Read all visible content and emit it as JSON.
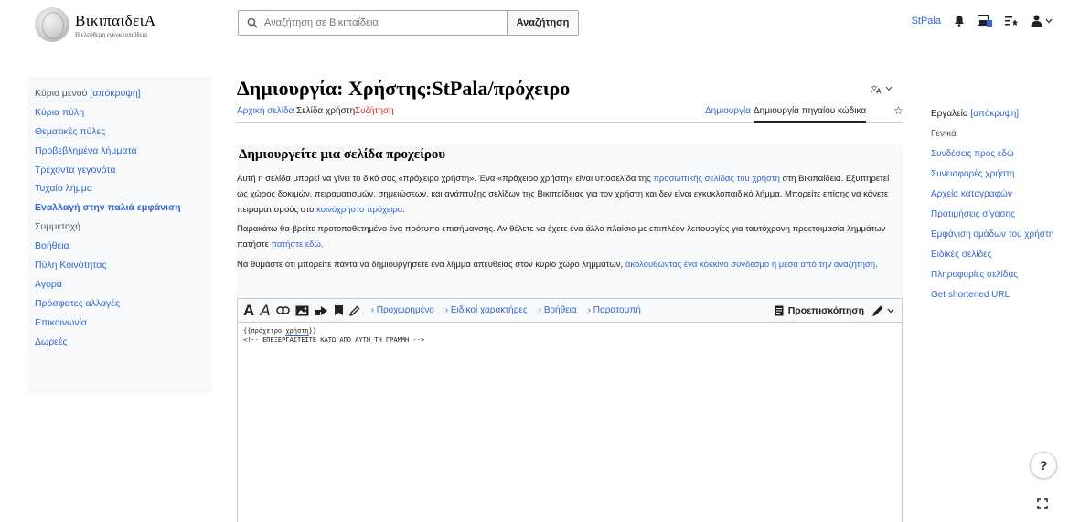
{
  "header": {
    "logo": {
      "wordmark": "ΒικιπαιδειΑ",
      "tagline": "Η ελεύθερη εγκυκλοπαίδεια"
    },
    "search": {
      "placeholder": "Αναζήτηση σε Βικιπαίδεια",
      "button_label": "Αναζήτηση"
    },
    "user_tools": {
      "username": "StPala"
    }
  },
  "sidebar": {
    "main_menu_label": "Κύριο μενού",
    "hide_label": "[απόκρυψη]",
    "items": [
      "Κύρια πύλη",
      "Θεματικές πύλες",
      "Προβεβλημένα λήμματα",
      "Τρέχοντα γεγονότα",
      "Τυχαίο λήμμα",
      "Εναλλαγή στην παλιά εμφάνιση",
      "Συμμετοχή",
      "Βοήθεια",
      "Πύλη Κοινότητας",
      "Αγορά",
      "Πρόσφατες αλλαγές",
      "Επικοινωνία",
      "Δωρεές"
    ]
  },
  "page": {
    "title": "Δημιουργία: Χρήστης:StPala/πρόχειρο",
    "tabs_left": [
      "Αρχική σελίδα",
      "Σελίδα χρήστη",
      "Συζήτηση"
    ],
    "tabs_right": [
      "Δημιουργία",
      "Δημιουργία πηγαίου κώδικα"
    ]
  },
  "content": {
    "heading": "Δημιουργείτε μια σελίδα προχείρου",
    "p1_a": "Αυτή η σελίδα μπορεί να γίνει το δικό σας «πρόχειρο χρήστη». Ένα «πρόχειρο χρήστη» είναι υποσελίδα της ",
    "p1_link": "προσωπικής σελίδας του χρήστη",
    "p1_b": " στη Βικιπαίδεια. Εξυπηρετεί ως χώρος δοκιμών, πειραματισμών, σημειώσεων, και ανάπτυξης σελίδων της Βικιπαίδειας για τον χρήστη και δεν είναι εγκυκλοπαιδικό λήμμα. Μπορείτε επίσης να κάνετε πειραματισμούς στο ",
    "p1_link2": "κοινόχρηστο πρόχειρο",
    "p1_c": ".",
    "p2_a": "Παρακάτω θα βρείτε προτοποθετημένο ένα πρότυπο επισήμανσης. Αν θέλετε να έχετε ένα άλλο πλαίσιο με επιπλέον λειτουργίες για ταυτόχρονη προετοιμασία λημμάτων πατήστε ",
    "p2_link": "πατήστε εδώ",
    "p2_b": ".",
    "p3_a": "Να θυμάστε ότι μπορείτε πάντα να δημιουργήσετε ένα λήμμα απευθείας στον κύριο χώρο λημμάτων, ",
    "p3_link": "ακολουθώντας ένα κόκκινο σύνδεσμο ή μέσα από την αναζήτηση",
    "p3_b": "."
  },
  "editor": {
    "toolbar_links": [
      "Προχωρημένο",
      "Ειδικοί χαρακτήρες",
      "Βοήθεια",
      "Παρατομπή"
    ],
    "preview_label": "Προεπισκόπηση",
    "line1_a": "{{πρόχειρο ",
    "line1_b": "χρήστη",
    "line1_c": "}}",
    "line2": "<!-- ΕΠΕΞΕΡΓΑΣΤΕΙΤΕ ΚΑΤΩ ΑΠΟ ΑΥΤΗ ΤΗ ΓΡΑΜΜΗ -->"
  },
  "tools": {
    "title": "Εργαλεία",
    "hide_label": "[απόκρυψη]",
    "section": "Γενικά",
    "items": [
      "Συνδέσεις προς εδώ",
      "Συνεισφορές χρήστη",
      "Αρχεία καταγραφών",
      "Προτιμήσεις σίγασης",
      "Εμφάνιση ομάδων του χρήστη",
      "Ειδικές σελίδες",
      "Πληροφορίες σελίδας",
      "Get shortened URL"
    ]
  },
  "floating": {
    "help_label": "?"
  },
  "colors": {
    "link": "#3366cc",
    "red_link": "#d73333",
    "sidebar_bg": "#f8f9fa"
  }
}
